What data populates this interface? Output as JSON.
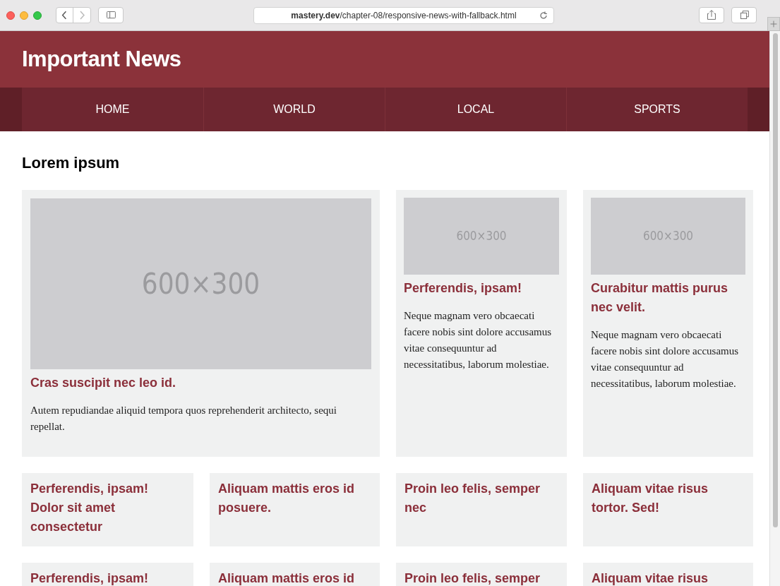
{
  "browser": {
    "url": "**mastery.dev**/chapter-08/responsive-news-with-fallback.html"
  },
  "site_title": "Important News",
  "nav": [
    {
      "label": "HOME"
    },
    {
      "label": "WORLD"
    },
    {
      "label": "LOCAL"
    },
    {
      "label": "SPORTS"
    }
  ],
  "section_heading": "Lorem ipsum",
  "stories": [
    {
      "kind": "feature",
      "image_label": "600×300",
      "title": "Cras suscipit nec leo id.",
      "body": "Autem repudiandae aliquid tempora quos reprehenderit architecto, sequi repellat."
    },
    {
      "kind": "image",
      "image_label": "600×300",
      "title": "Perferendis, ipsam!",
      "body": "Neque magnam vero obcaecati facere nobis sint dolore accusamus vitae consequuntur ad necessitatibus, laborum molestiae."
    },
    {
      "kind": "image",
      "image_label": "600×300",
      "title": "Curabitur mattis purus nec velit.",
      "body": "Neque magnam vero obcaecati facere nobis sint dolore accusamus vitae consequuntur ad necessitatibus, laborum molestiae."
    },
    {
      "kind": "headline",
      "title": "Perferendis, ipsam! Dolor sit amet consectetur"
    },
    {
      "kind": "headline",
      "title": "Aliquam mattis eros id posuere."
    },
    {
      "kind": "headline",
      "title": "Proin leo felis, semper nec"
    },
    {
      "kind": "headline",
      "title": "Aliquam vitae risus tortor. Sed!"
    },
    {
      "kind": "headline",
      "title": "Perferendis, ipsam!"
    },
    {
      "kind": "headline",
      "title": "Aliquam mattis eros id"
    },
    {
      "kind": "headline",
      "title": "Proin leo felis, semper"
    },
    {
      "kind": "headline",
      "title": "Aliquam vitae risus"
    }
  ]
}
